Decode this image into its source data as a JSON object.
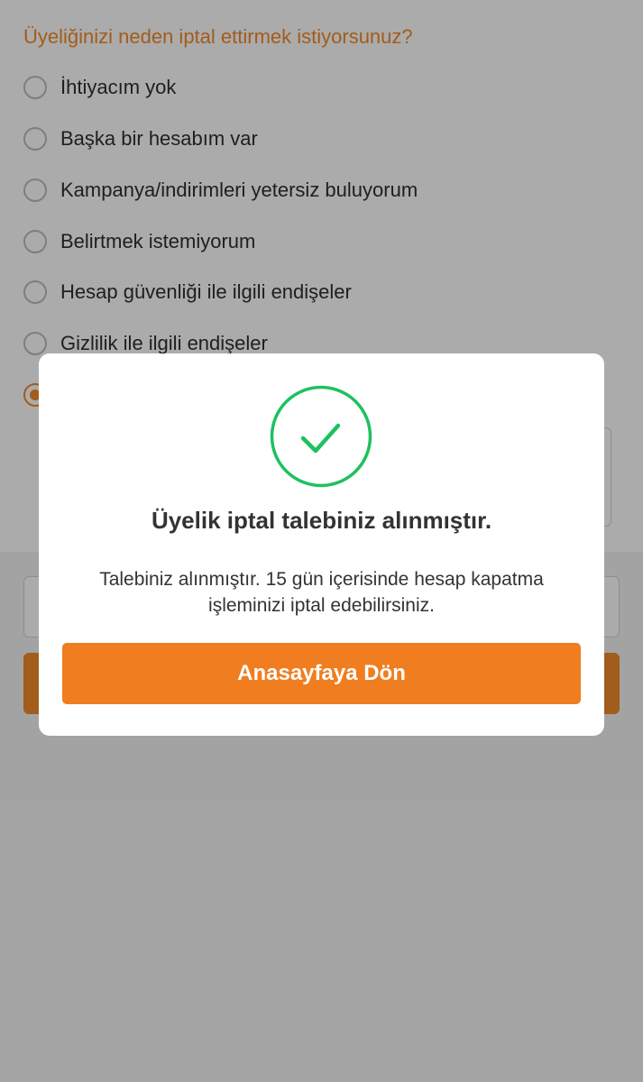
{
  "form": {
    "question": "Üyeliğinizi neden iptal ettirmek istiyorsunuz?",
    "options": [
      {
        "label": "İhtiyacım yok",
        "selected": false
      },
      {
        "label": "Başka bir hesabım var",
        "selected": false
      },
      {
        "label": "Kampanya/indirimleri yetersiz buluyorum",
        "selected": false
      },
      {
        "label": "Belirtmek istemiyorum",
        "selected": false
      },
      {
        "label": "Hesap güvenliği ile ilgili endişeler",
        "selected": false
      },
      {
        "label": "Gizlilik ile ilgili endişeler",
        "selected": false
      },
      {
        "label": "",
        "selected": true
      }
    ]
  },
  "modal": {
    "icon": "checkmark-circle-icon",
    "title": "Üyelik iptal talebiniz alınmıştır.",
    "description": "Talebiniz alınmıştır. 15 gün içerisinde hesap kapatma işleminizi iptal edebilirsiniz.",
    "button_label": "Anasayfaya Dön"
  },
  "colors": {
    "accent": "#f28a2b",
    "success": "#1ec15f",
    "button": "#f07d1f"
  }
}
